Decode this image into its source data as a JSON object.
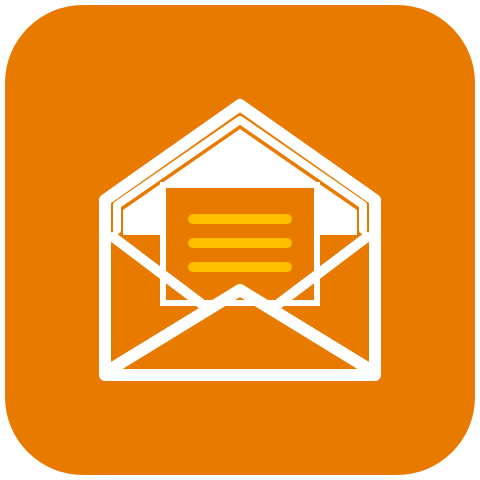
{
  "icon": {
    "name": "open-envelope-mail-icon",
    "colors": {
      "background": "#E87A00",
      "stroke": "#FFFFFF",
      "letter_lines": "#FFC000"
    }
  }
}
